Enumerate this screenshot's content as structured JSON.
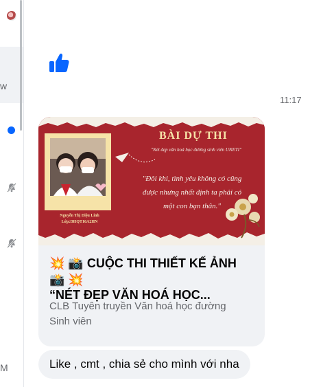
{
  "sidebar": {
    "letters": [
      "w",
      "M"
    ]
  },
  "chat": {
    "timestamp": "11:17"
  },
  "shared_post": {
    "image": {
      "heading": "BÀI DỰ THI",
      "subheading": "\"Nét đẹp văn hoá học đường sinh viên UNETI\"",
      "quote_lines": [
        "\"Đôi khi, tình yêu không có cũng",
        "được nhưng nhất định ta phải có",
        "một con bạn thân.\""
      ],
      "caption_name": "Nguyễn Thị Diệu Linh",
      "caption_class": "Lớp:DHQT16A2HN"
    },
    "title_line1": "💥 📸 CUỘC THI THIẾT KẾ ẢNH",
    "title_line2": "📸 💥",
    "title_line3": "“NÉT ĐẸP VĂN HOÁ HỌC...",
    "subtitle_line1": "CLB Tuyên truyền Văn hoá học đường",
    "subtitle_line2": "Sinh viên"
  },
  "message": {
    "text": "Like , cmt , chia sẻ cho mình với nha"
  },
  "colors": {
    "accent": "#0866ff",
    "poster_red": "#a8252d",
    "bubble": "#f0f2f5"
  }
}
